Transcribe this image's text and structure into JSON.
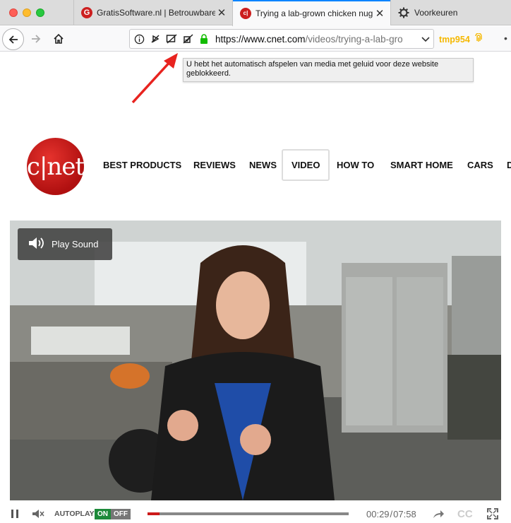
{
  "browser": {
    "tabs": [
      {
        "label": "GratisSoftware.nl | Betrouwbare",
        "favicon": "G",
        "active": false
      },
      {
        "label": "Trying a lab-grown chicken nug",
        "favicon": "c|",
        "active": true
      },
      {
        "label": "Voorkeuren",
        "favicon": "gear-icon",
        "active": false
      }
    ],
    "url_host": "https://www.cnet.com",
    "url_path": "/videos/trying-a-lab-gro",
    "extension_label": "tmp954",
    "tooltip": "U hebt het automatisch afspelen van media met geluid voor deze website geblokkeerd."
  },
  "site": {
    "logo_text": "c|net",
    "menu": [
      "BEST PRODUCTS",
      "REVIEWS",
      "NEWS",
      "VIDEO",
      "HOW TO",
      "SMART HOME",
      "CARS",
      "D"
    ],
    "selected_menu": "VIDEO"
  },
  "video": {
    "play_sound_label": "Play Sound",
    "autoplay_label": "AUTOPLAY",
    "on_label": "ON",
    "off_label": "OFF",
    "current_time": "00:29",
    "separator": "/",
    "duration": "07:58",
    "progress": 0.06,
    "cc_label": "CC"
  },
  "colors": {
    "accent": "#0a84ff",
    "brand_red": "#cc1f1f",
    "autoplay_on": "#1d8a3a"
  }
}
